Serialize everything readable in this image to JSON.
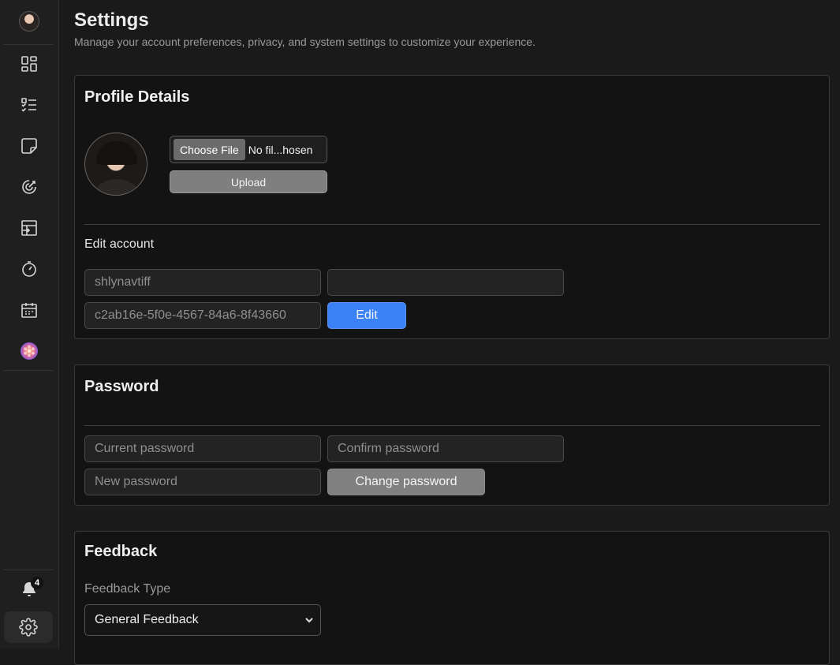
{
  "sidebar": {
    "items": [
      {
        "icon": "avatar"
      },
      {
        "icon": "dashboard-icon"
      },
      {
        "icon": "checklist-icon"
      },
      {
        "icon": "sticky-note-icon"
      },
      {
        "icon": "target-icon"
      },
      {
        "icon": "board-import-icon"
      },
      {
        "icon": "timer-icon"
      },
      {
        "icon": "calendar-icon"
      },
      {
        "icon": "app-logo-icon"
      }
    ],
    "notification_count": "4"
  },
  "page": {
    "title": "Settings",
    "subtitle": "Manage your account preferences, privacy, and system settings to customize your experience."
  },
  "profile": {
    "title": "Profile Details",
    "choose_file_label": "Choose File",
    "file_name": "No fil...hosen",
    "upload_label": "Upload",
    "edit_account_label": "Edit account",
    "username_value": "shlynavtiff",
    "second_field_value": "",
    "id_value": "c2ab16e-5f0e-4567-84a6-8f43660",
    "edit_label": "Edit"
  },
  "password": {
    "title": "Password",
    "current_placeholder": "Current password",
    "confirm_placeholder": "Confirm password",
    "new_placeholder": "New password",
    "change_label": "Change password"
  },
  "feedback": {
    "title": "Feedback",
    "type_label": "Feedback Type",
    "selected_type": "General Feedback"
  },
  "colors": {
    "accent": "#3b82f6",
    "background": "#1a1a1a",
    "card": "#131313"
  }
}
